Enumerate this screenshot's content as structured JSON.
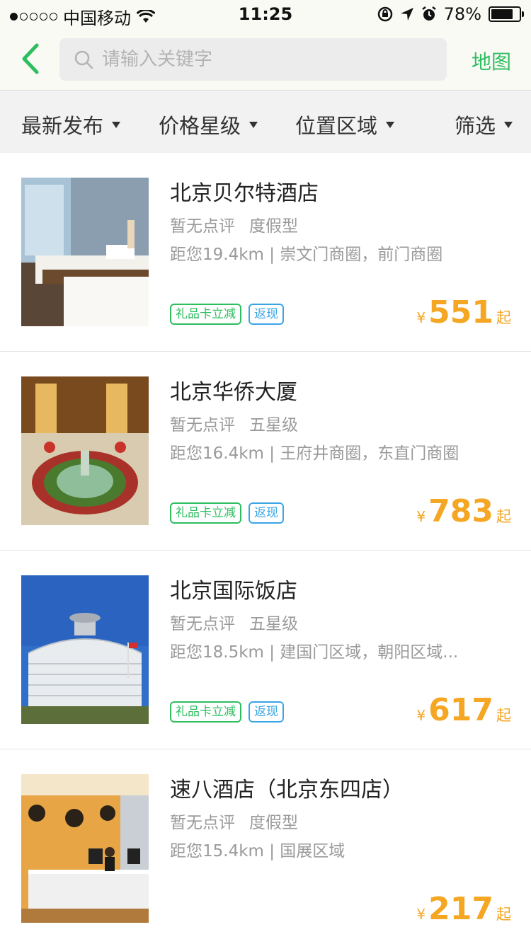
{
  "status_bar": {
    "carrier": "中国移动",
    "time": "11:25",
    "battery_percent": "78%",
    "battery_level": 0.78,
    "icons": [
      "wifi-icon",
      "orientation-lock-icon",
      "location-arrow-icon",
      "alarm-icon",
      "battery-icon"
    ]
  },
  "navbar": {
    "search_placeholder": "请输入关键字",
    "map_label": "地图"
  },
  "filters": [
    "最新发布",
    "价格星级",
    "位置区域",
    "筛选"
  ],
  "hotels": [
    {
      "name": "北京贝尔特酒店",
      "review": "暂无点评",
      "category": "度假型",
      "location": "距您19.4km | 崇文门商圈，前门商圈",
      "tags": [
        "礼品卡立减",
        "返现"
      ],
      "currency": "¥",
      "price": "551",
      "suffix": "起"
    },
    {
      "name": "北京华侨大厦",
      "review": "暂无点评",
      "category": "五星级",
      "location": "距您16.4km | 王府井商圈，东直门商圈",
      "tags": [
        "礼品卡立减",
        "返现"
      ],
      "currency": "¥",
      "price": "783",
      "suffix": "起"
    },
    {
      "name": "北京国际饭店",
      "review": "暂无点评",
      "category": "五星级",
      "location": "距您18.5km | 建国门区域，朝阳区域...",
      "tags": [
        "礼品卡立减",
        "返现"
      ],
      "currency": "¥",
      "price": "617",
      "suffix": "起"
    },
    {
      "name": "速八酒店（北京东四店）",
      "review": "暂无点评",
      "category": "度假型",
      "location": "距您15.4km | 国展区域",
      "tags": [],
      "currency": "¥",
      "price": "217",
      "suffix": "起"
    }
  ],
  "colors": {
    "accent_green": "#2dbe60",
    "tag_blue": "#3aa5e6",
    "price_orange": "#f5a623"
  }
}
